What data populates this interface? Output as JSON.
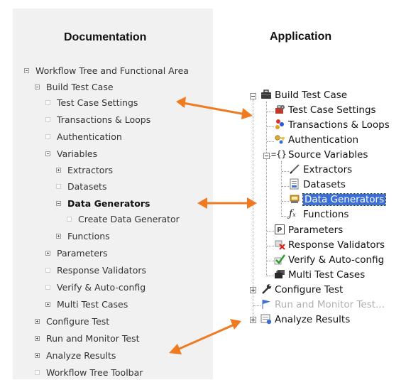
{
  "headings": {
    "documentation": "Documentation",
    "application": "Application"
  },
  "doc_tree": [
    {
      "label": "Workflow Tree and Functional Area",
      "marker": "minus"
    },
    {
      "label": "Build Test Case",
      "marker": "minus"
    },
    {
      "label": "Test Case Settings",
      "marker": "leaf"
    },
    {
      "label": "Transactions & Loops",
      "marker": "leaf"
    },
    {
      "label": "Authentication",
      "marker": "leaf"
    },
    {
      "label": "Variables",
      "marker": "minus"
    },
    {
      "label": "Extractors",
      "marker": "plus"
    },
    {
      "label": "Datasets",
      "marker": "leaf"
    },
    {
      "label": "Data Generators",
      "marker": "minus",
      "bold": true
    },
    {
      "label": "Create Data Generator",
      "marker": "leaf"
    },
    {
      "label": "Functions",
      "marker": "plus"
    },
    {
      "label": "Parameters",
      "marker": "plus"
    },
    {
      "label": "Response Validators",
      "marker": "leaf"
    },
    {
      "label": "Verify & Auto-config",
      "marker": "leaf"
    },
    {
      "label": "Multi Test Cases",
      "marker": "plus"
    },
    {
      "label": "Configure Test",
      "marker": "plus"
    },
    {
      "label": "Run and Monitor Test",
      "marker": "plus"
    },
    {
      "label": "Analyze Results",
      "marker": "plus"
    },
    {
      "label": "Workflow Tree Toolbar",
      "marker": "leaf"
    }
  ],
  "app_tree": [
    {
      "label": "Build Test Case",
      "icon": "briefcase-icon"
    },
    {
      "label": "Test Case Settings",
      "icon": "settings-toolbox-icon"
    },
    {
      "label": "Transactions & Loops",
      "icon": "transactions-icon"
    },
    {
      "label": "Authentication",
      "icon": "key-icon"
    },
    {
      "label": "Source Variables",
      "icon": "braces-icon"
    },
    {
      "label": "Extractors",
      "icon": "pen-icon"
    },
    {
      "label": "Datasets",
      "icon": "dataset-icon"
    },
    {
      "label": "Data Generators",
      "icon": "data-generator-icon",
      "selected": true
    },
    {
      "label": "Functions",
      "icon": "function-icon"
    },
    {
      "label": "Parameters",
      "icon": "parameter-icon"
    },
    {
      "label": "Response Validators",
      "icon": "validator-icon"
    },
    {
      "label": "Verify & Auto-config",
      "icon": "checkmark-icon"
    },
    {
      "label": "Multi Test Cases",
      "icon": "multi-briefcase-icon"
    },
    {
      "label": "Configure Test",
      "icon": "wrench-icon"
    },
    {
      "label": "Run and Monitor Test...",
      "icon": "flag-icon",
      "disabled": true
    },
    {
      "label": "Analyze Results",
      "icon": "results-icon"
    }
  ],
  "colors": {
    "arrow": "#f07a20",
    "selection": "#3a6fd8",
    "doc_panel": "#f1f1f1"
  }
}
